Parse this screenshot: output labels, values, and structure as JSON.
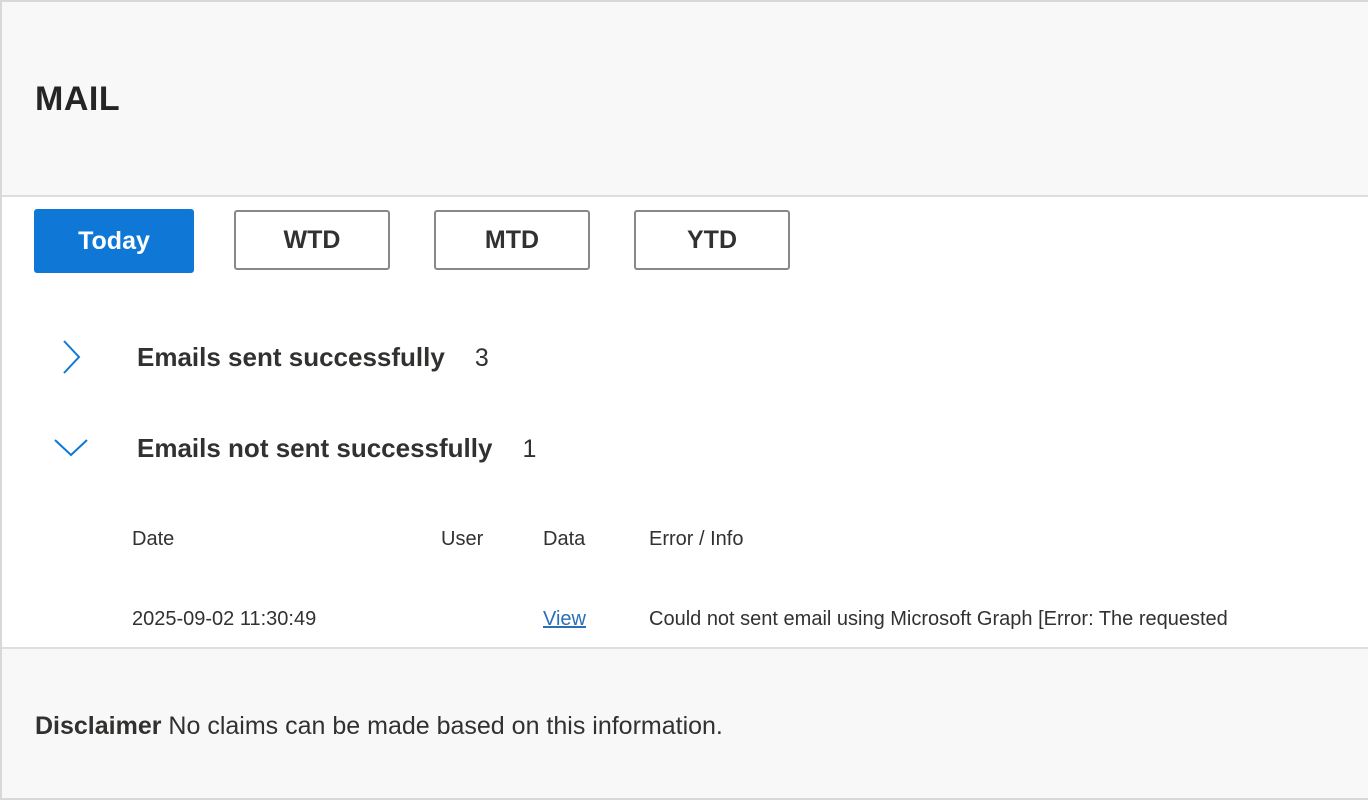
{
  "header": {
    "title": "MAIL"
  },
  "filters": {
    "buttons": [
      {
        "label": "Today",
        "active": true
      },
      {
        "label": "WTD",
        "active": false
      },
      {
        "label": "MTD",
        "active": false
      },
      {
        "label": "YTD",
        "active": false
      }
    ]
  },
  "groups": [
    {
      "label": "Emails sent successfully",
      "count": "3",
      "expanded": false,
      "icon": "chevron-right-icon"
    },
    {
      "label": "Emails not sent successfully",
      "count": "1",
      "expanded": true,
      "icon": "chevron-down-icon"
    }
  ],
  "table": {
    "columns": [
      "Date",
      "User",
      "Data",
      "Error / Info"
    ],
    "rows": [
      {
        "date": "2025-09-02 11:30:49",
        "user": "",
        "data": "View",
        "error": "Could not sent email using Microsoft Graph [Error: The requested"
      }
    ]
  },
  "footer": {
    "disclaimer_label": "Disclaimer",
    "disclaimer_text": "No claims can be made based on this information."
  },
  "colors": {
    "accent": "#0f78d7",
    "link": "#2a6fb8",
    "panel_bg": "#f8f8f8"
  }
}
